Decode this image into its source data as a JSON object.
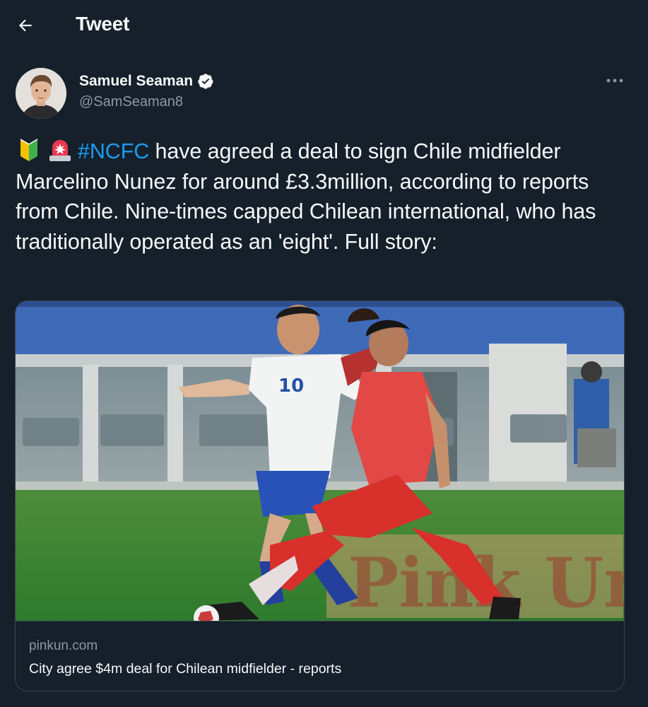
{
  "header": {
    "title": "Tweet",
    "back_icon": "arrow-left-icon"
  },
  "author": {
    "display_name": "Samuel Seaman",
    "handle": "@SamSeaman8",
    "verified_icon": "verified-badge-icon",
    "more_icon": "more-horizontal-icon"
  },
  "tweet": {
    "emojis": [
      "beginner-symbol-emoji",
      "police-light-emoji"
    ],
    "hashtag": "#NCFC",
    "text": " have agreed a deal to sign Chile midfielder Marcelino Nunez for around £3.3million, according to reports from Chile. Nine-times capped Chilean international, who has traditionally operated as an 'eight'. Full story:"
  },
  "card": {
    "domain": "pinkun.com",
    "title": "City agree $4m deal for Chilean midfielder - reports",
    "image_watermark": "Pink Un",
    "jersey_number": "10"
  },
  "colors": {
    "background": "#15202b",
    "text": "#f7f9f9",
    "secondary_text": "#8b98a5",
    "accent": "#1d9bf0",
    "border": "#38444d"
  }
}
